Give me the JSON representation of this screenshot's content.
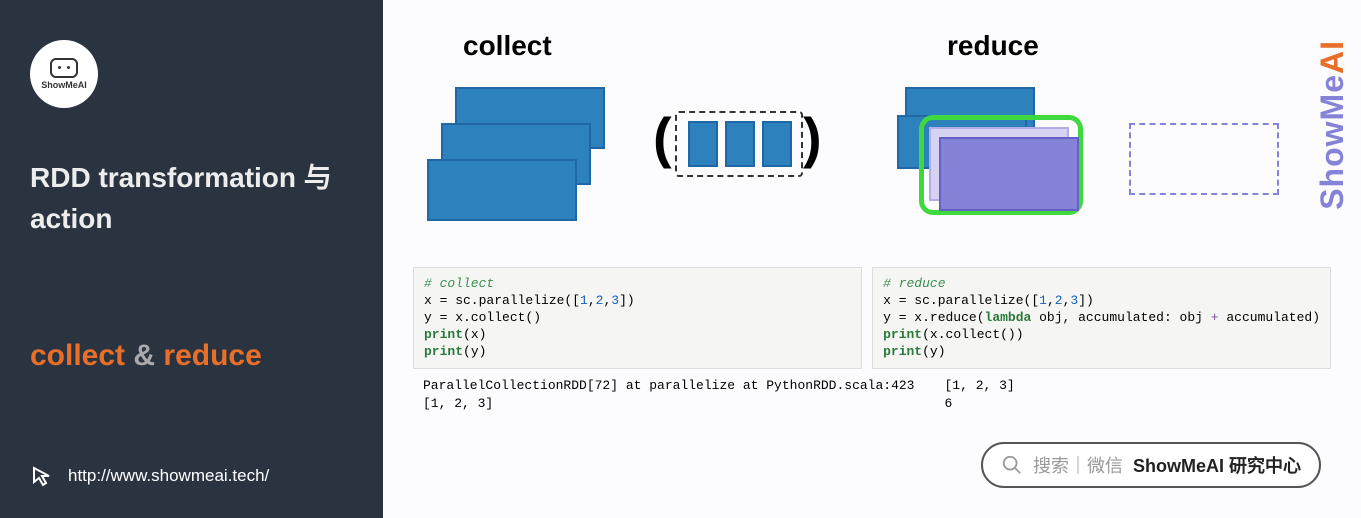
{
  "sidebar": {
    "logo_text": "ShowMeAI",
    "title": "RDD transformation 与action",
    "subtitle_a": "collect",
    "subtitle_amp": " & ",
    "subtitle_b": "reduce",
    "url": "http://www.showmeai.tech/"
  },
  "content": {
    "collect_title": "collect",
    "reduce_title": "reduce",
    "collect_code": {
      "comment": "# collect",
      "l1a": "x = sc.parallelize([",
      "l1n1": "1",
      "l1c1": ",",
      "l1n2": "2",
      "l1c2": ",",
      "l1n3": "3",
      "l1b": "])",
      "l2": "y = x.collect()",
      "l3a": "print",
      "l3b": "(x)",
      "l4a": "print",
      "l4b": "(y)"
    },
    "reduce_code": {
      "comment": "# reduce",
      "l1a": "x = sc.parallelize([",
      "l1n1": "1",
      "l1c1": ",",
      "l1n2": "2",
      "l1c2": ",",
      "l1n3": "3",
      "l1b": "])",
      "l2a": "y = x.reduce(",
      "l2lam": "lambda",
      "l2b": " obj, accumulated: obj ",
      "l2op": "+",
      "l2c": " accumulated)",
      "l3a": "print",
      "l3b": "(x.collect())",
      "l4a": "print",
      "l4b": "(y)"
    },
    "collect_output": "ParallelCollectionRDD[72] at parallelize at PythonRDD.scala:423\n[1, 2, 3]",
    "reduce_output": "[1, 2, 3]\n6"
  },
  "search": {
    "grey": "搜索｜微信",
    "bold": "ShowMeAI 研究中心"
  },
  "brand_vert": {
    "a": "ShowMe",
    "b": "AI"
  }
}
